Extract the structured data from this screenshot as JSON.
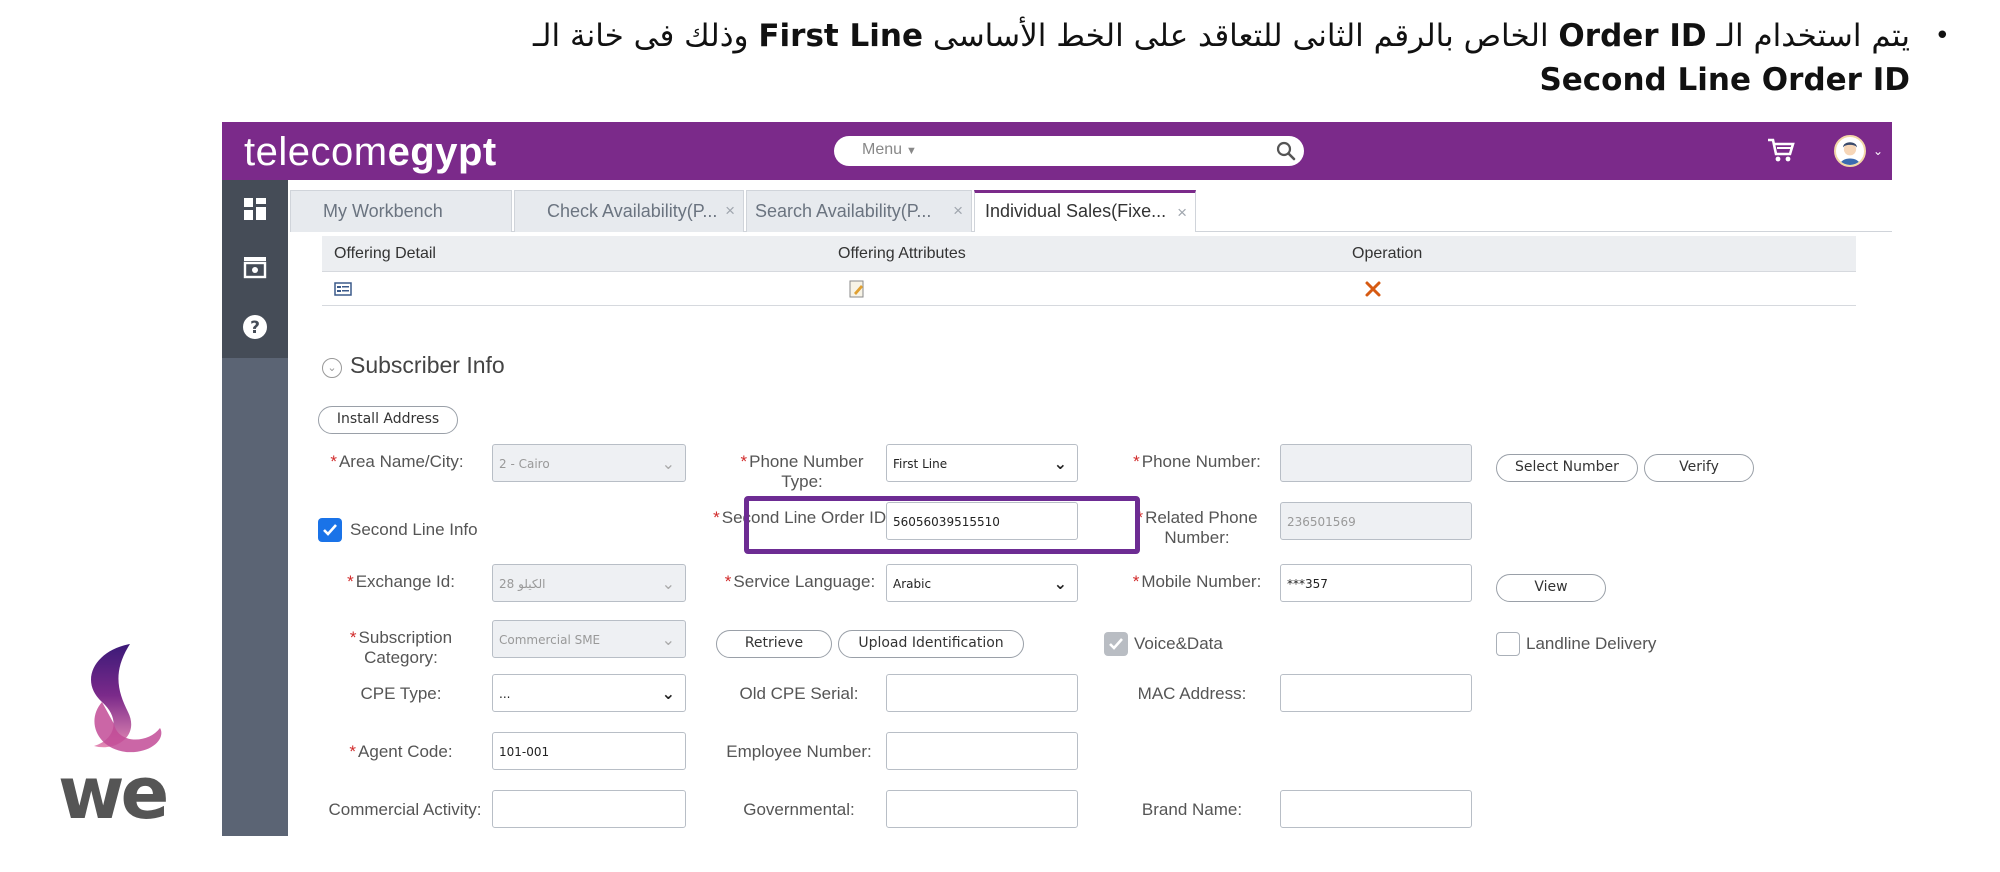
{
  "slide": {
    "line1_prefix": "يتم استخدام الـ ",
    "order_id": "Order ID",
    "line1_mid": " الخاص بالرقم الثانى للتعاقد على الخط الأساسى ",
    "first_line": "First Line",
    "line1_suffix": " وذلك فى خانة الـ",
    "line2": "Second Line Order ID",
    "bullet": "•"
  },
  "app": {
    "brand_light": "telecom",
    "brand_bold": "egypt",
    "menu_label": "Menu",
    "colors": {
      "brand_purple": "#7b2a8a",
      "highlight": "#6d2c93",
      "sidebar": "#5b6474",
      "required": "#d12a2a",
      "checkbox": "#1a73e8"
    }
  },
  "tabs": [
    {
      "label": "My Workbench",
      "closable": false
    },
    {
      "label": "Check Availability(P...",
      "closable": true
    },
    {
      "label": "Search Availability(P...",
      "closable": true
    },
    {
      "label": "Individual Sales(Fixe...",
      "closable": true,
      "active": true
    }
  ],
  "tab_close": "×",
  "offering_table": {
    "headers": [
      "Offering Detail",
      "Offering Attributes",
      "Operation"
    ],
    "row_icons": [
      "detail-icon",
      "edit-icon",
      "delete-icon"
    ]
  },
  "subscriber": {
    "title": "Subscriber Info",
    "install_address_button": "Install Address",
    "area_label": "Area Name/City:",
    "area_value": "2 - Cairo",
    "phone_type_label": "Phone Number Type:",
    "phone_type_value": "First Line",
    "phone_number_label": "Phone Number:",
    "phone_number_value": "",
    "select_number_button": "Select Number",
    "verify_button": "Verify",
    "second_line_label": "Second Line Info",
    "second_line_checked": true,
    "second_line_order_label": "Second Line Order ID:",
    "second_line_order_value": "56056039515510",
    "related_phone_label": "Related Phone Number:",
    "related_phone_value": "236501569",
    "exchange_label": "Exchange Id:",
    "exchange_value": "الكيلو 28",
    "service_language_label": "Service Language:",
    "service_language_value": "Arabic",
    "mobile_label": "Mobile Number:",
    "mobile_value": "***357",
    "view_button": "View",
    "subscription_category_label": "Subscription Category:",
    "subscription_category_value": "Commercial SME",
    "retrieve_button": "Retrieve",
    "upload_button": "Upload Identification",
    "voice_data_label": "Voice&Data",
    "voice_data_checked": true,
    "landline_delivery_label": "Landline Delivery",
    "landline_delivery_checked": false,
    "cpe_type_label": "CPE Type:",
    "cpe_type_value": "...",
    "old_cpe_label": "Old CPE Serial:",
    "old_cpe_value": "",
    "mac_label": "MAC Address:",
    "mac_value": "",
    "agent_code_label": "Agent Code:",
    "agent_code_value": "101-001",
    "employee_number_label": "Employee Number:",
    "employee_number_value": "",
    "commercial_activity_label": "Commercial Activity:",
    "commercial_activity_value": "",
    "governmental_label": "Governmental:",
    "governmental_value": "",
    "brand_name_label": "Brand Name:",
    "brand_name_value": "",
    "required_mark": "*"
  }
}
